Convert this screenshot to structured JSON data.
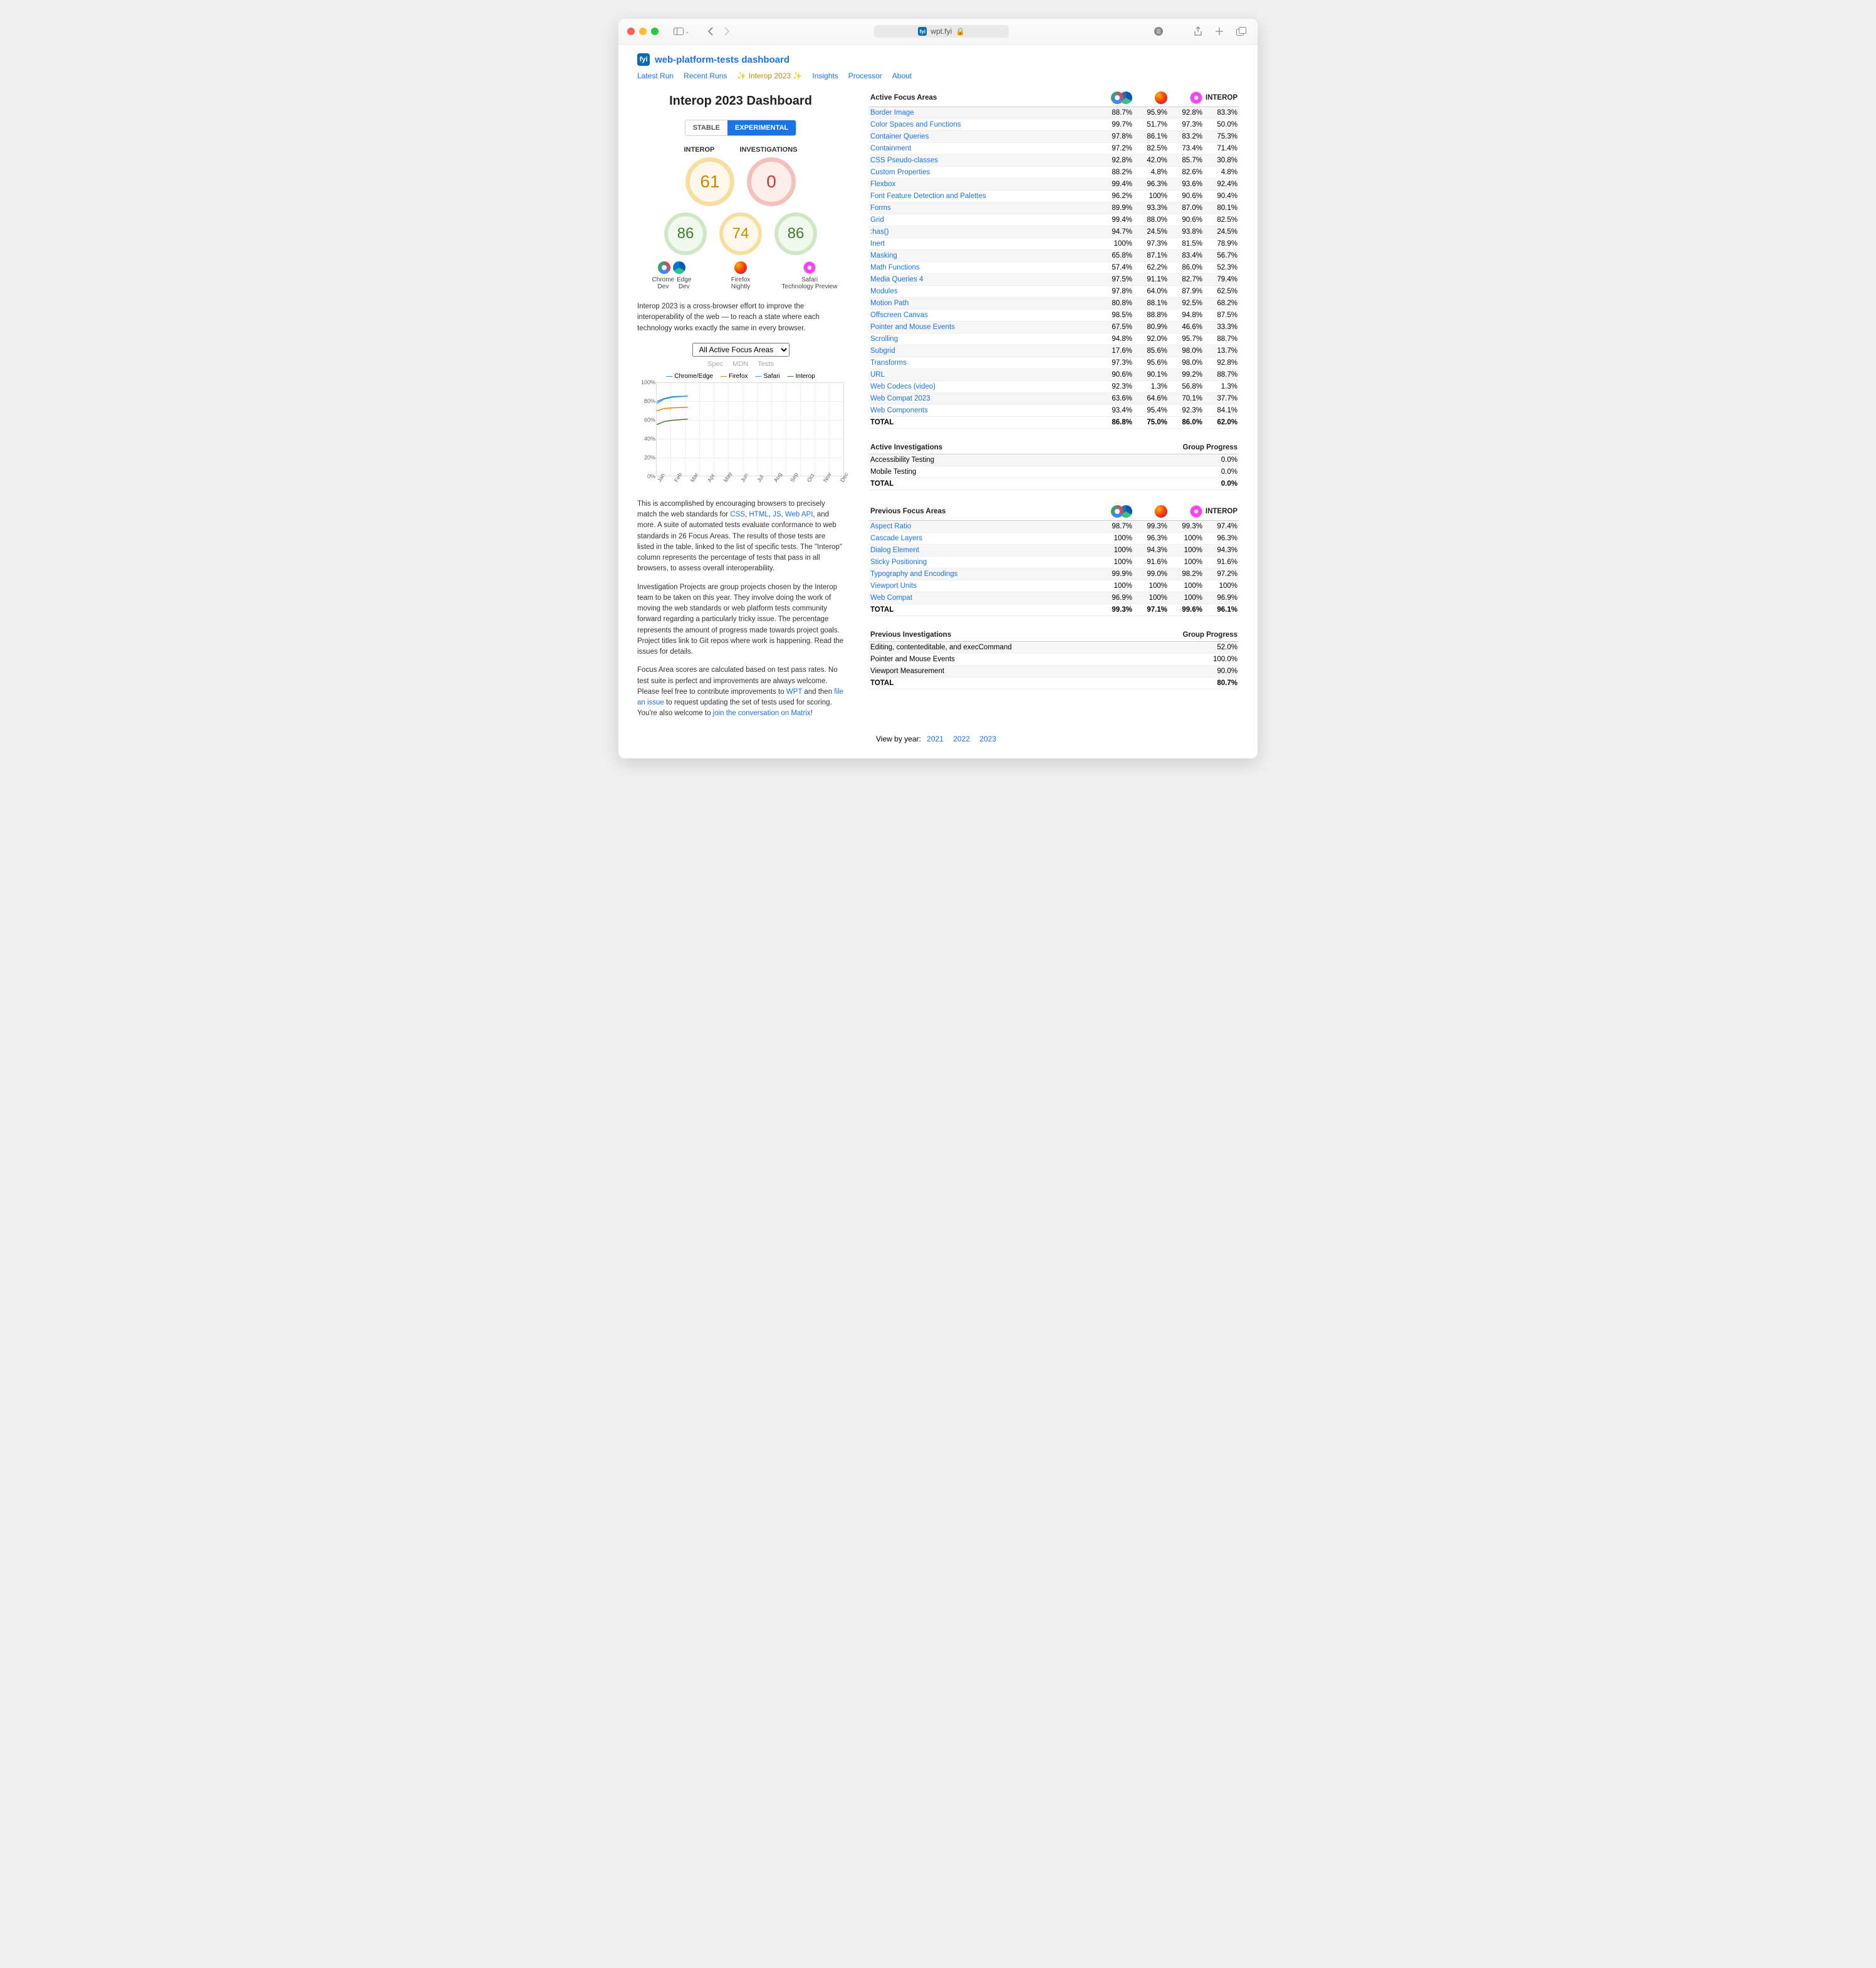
{
  "window": {
    "url": "wpt.fyi"
  },
  "site": {
    "title": "web-platform-tests dashboard",
    "nav": [
      "Latest Run",
      "Recent Runs",
      "✨ Interop 2023 ✨",
      "Insights",
      "Processor",
      "About"
    ]
  },
  "page": {
    "title": "Interop 2023 Dashboard",
    "toggle": {
      "left": "STABLE",
      "right": "EXPERIMENTAL"
    },
    "ring_labels": {
      "interop": "INTEROP",
      "invest": "INVESTIGATIONS"
    },
    "rings": {
      "interop": "61",
      "invest": "0",
      "chrome_edge": "86",
      "firefox": "74",
      "safari": "86"
    },
    "browsers": {
      "col1": "Chrome\nDev",
      "col1b": "Edge\nDev",
      "col2": "Firefox\nNightly",
      "col3": "Safari\nTechnology Preview"
    },
    "intro": "Interop 2023 is a cross-browser effort to improve the interoperability of the web — to reach a state where each technology works exactly the same in every browser.",
    "select": "All Active Focus Areas",
    "sublinks": [
      "Spec",
      "MDN",
      "Tests"
    ],
    "legend": [
      "Chrome/Edge",
      "Firefox",
      "Safari",
      "Interop"
    ],
    "chart": {
      "y": [
        "100%",
        "80%",
        "60%",
        "40%",
        "20%",
        "0%"
      ],
      "x": [
        "Jan",
        "Feb",
        "Mar",
        "Apr",
        "May",
        "Jun",
        "Jul",
        "Aug",
        "Sep",
        "Oct",
        "Nov",
        "Dec"
      ]
    },
    "p2a": "This is accomplished by encouraging browsers to precisely match the web standards for ",
    "p2_links": [
      "CSS",
      "HTML",
      "JS",
      "Web API"
    ],
    "p2b": ", and more. A suite of automated tests evaluate conformance to web standards in 26 Focus Areas. The results of those tests are listed in the table, linked to the list of specific tests. The \"Interop\" column represents the percentage of tests that pass in all browsers, to assess overall interoperability.",
    "p3": "Investigation Projects are group projects chosen by the Interop team to be taken on this year. They involve doing the work of moving the web standards or web platform tests community forward regarding a particularly tricky issue. The percentage represents the amount of progress made towards project goals. Project titles link to Git repos where work is happening. Read the issues for details.",
    "p4a": "Focus Area scores are calculated based on test pass rates. No test suite is perfect and improvements are always welcome. Please feel free to contribute improvements to ",
    "p4_wpt": "WPT",
    "p4b": " and then ",
    "p4_issue": "file an issue",
    "p4c": " to request updating the set of tests used for scoring. You're also welcome to ",
    "p4_matrix": "join the conversation on Matrix",
    "p4d": "!"
  },
  "tables": {
    "active_header": "Active Focus Areas",
    "interop_header": "INTEROP",
    "active_rows": [
      {
        "name": "Border Image",
        "v": [
          "88.7%",
          "95.9%",
          "92.8%",
          "83.3%"
        ]
      },
      {
        "name": "Color Spaces and Functions",
        "v": [
          "99.7%",
          "51.7%",
          "97.3%",
          "50.0%"
        ]
      },
      {
        "name": "Container Queries",
        "v": [
          "97.8%",
          "86.1%",
          "83.2%",
          "75.3%"
        ]
      },
      {
        "name": "Containment",
        "v": [
          "97.2%",
          "82.5%",
          "73.4%",
          "71.4%"
        ]
      },
      {
        "name": "CSS Pseudo-classes",
        "v": [
          "92.8%",
          "42.0%",
          "85.7%",
          "30.8%"
        ]
      },
      {
        "name": "Custom Properties",
        "v": [
          "88.2%",
          "4.8%",
          "82.6%",
          "4.8%"
        ]
      },
      {
        "name": "Flexbox",
        "v": [
          "99.4%",
          "96.3%",
          "93.6%",
          "92.4%"
        ]
      },
      {
        "name": "Font Feature Detection and Palettes",
        "v": [
          "96.2%",
          "100%",
          "90.6%",
          "90.4%"
        ]
      },
      {
        "name": "Forms",
        "v": [
          "89.9%",
          "93.3%",
          "87.0%",
          "80.1%"
        ]
      },
      {
        "name": "Grid",
        "v": [
          "99.4%",
          "88.0%",
          "90.6%",
          "82.5%"
        ]
      },
      {
        "name": ":has()",
        "v": [
          "94.7%",
          "24.5%",
          "93.8%",
          "24.5%"
        ]
      },
      {
        "name": "Inert",
        "v": [
          "100%",
          "97.3%",
          "81.5%",
          "78.9%"
        ]
      },
      {
        "name": "Masking",
        "v": [
          "65.8%",
          "87.1%",
          "83.4%",
          "56.7%"
        ]
      },
      {
        "name": "Math Functions",
        "v": [
          "57.4%",
          "62.2%",
          "86.0%",
          "52.3%"
        ]
      },
      {
        "name": "Media Queries 4",
        "v": [
          "97.5%",
          "91.1%",
          "82.7%",
          "79.4%"
        ]
      },
      {
        "name": "Modules",
        "v": [
          "97.8%",
          "64.0%",
          "87.9%",
          "62.5%"
        ]
      },
      {
        "name": "Motion Path",
        "v": [
          "80.8%",
          "88.1%",
          "92.5%",
          "68.2%"
        ]
      },
      {
        "name": "Offscreen Canvas",
        "v": [
          "98.5%",
          "88.8%",
          "94.8%",
          "87.5%"
        ]
      },
      {
        "name": "Pointer and Mouse Events",
        "v": [
          "67.5%",
          "80.9%",
          "46.6%",
          "33.3%"
        ]
      },
      {
        "name": "Scrolling",
        "v": [
          "94.8%",
          "92.0%",
          "95.7%",
          "88.7%"
        ]
      },
      {
        "name": "Subgrid",
        "v": [
          "17.6%",
          "85.6%",
          "98.0%",
          "13.7%"
        ]
      },
      {
        "name": "Transforms",
        "v": [
          "97.3%",
          "95.6%",
          "98.0%",
          "92.8%"
        ]
      },
      {
        "name": "URL",
        "v": [
          "90.6%",
          "90.1%",
          "99.2%",
          "88.7%"
        ]
      },
      {
        "name": "Web Codecs (video)",
        "v": [
          "92.3%",
          "1.3%",
          "56.8%",
          "1.3%"
        ]
      },
      {
        "name": "Web Compat 2023",
        "v": [
          "63.6%",
          "64.6%",
          "70.1%",
          "37.7%"
        ]
      },
      {
        "name": "Web Components",
        "v": [
          "93.4%",
          "95.4%",
          "92.3%",
          "84.1%"
        ]
      }
    ],
    "active_total": {
      "name": "TOTAL",
      "v": [
        "86.8%",
        "75.0%",
        "86.0%",
        "62.0%"
      ]
    },
    "invest_header": "Active Investigations",
    "invest_col": "Group Progress",
    "invest_rows": [
      {
        "name": "Accessibility Testing",
        "v": "0.0%"
      },
      {
        "name": "Mobile Testing",
        "v": "0.0%"
      }
    ],
    "invest_total": {
      "name": "TOTAL",
      "v": "0.0%"
    },
    "prev_header": "Previous Focus Areas",
    "prev_rows": [
      {
        "name": "Aspect Ratio",
        "v": [
          "98.7%",
          "99.3%",
          "99.3%",
          "97.4%"
        ]
      },
      {
        "name": "Cascade Layers",
        "v": [
          "100%",
          "96.3%",
          "100%",
          "96.3%"
        ]
      },
      {
        "name": "Dialog Element",
        "v": [
          "100%",
          "94.3%",
          "100%",
          "94.3%"
        ]
      },
      {
        "name": "Sticky Positioning",
        "v": [
          "100%",
          "91.6%",
          "100%",
          "91.6%"
        ]
      },
      {
        "name": "Typography and Encodings",
        "v": [
          "99.9%",
          "99.0%",
          "98.2%",
          "97.2%"
        ]
      },
      {
        "name": "Viewport Units",
        "v": [
          "100%",
          "100%",
          "100%",
          "100%"
        ]
      },
      {
        "name": "Web Compat",
        "v": [
          "96.9%",
          "100%",
          "100%",
          "96.9%"
        ]
      }
    ],
    "prev_total": {
      "name": "TOTAL",
      "v": [
        "99.3%",
        "97.1%",
        "99.6%",
        "96.1%"
      ]
    },
    "pinv_header": "Previous Investigations",
    "pinv_col": "Group Progress",
    "pinv_rows": [
      {
        "name": "Editing, contenteditable, and execCommand",
        "v": "52.0%"
      },
      {
        "name": "Pointer and Mouse Events",
        "v": "100.0%"
      },
      {
        "name": "Viewport Measurement",
        "v": "90.0%"
      }
    ],
    "pinv_total": {
      "name": "TOTAL",
      "v": "80.7%"
    }
  },
  "footer": {
    "label": "View by year:",
    "years": [
      "2021",
      "2022",
      "2023"
    ]
  },
  "chart_data": {
    "type": "line",
    "title": "All Active Focus Areas",
    "xlabel": "",
    "ylabel": "",
    "x": [
      "Jan",
      "Feb",
      "Mar",
      "Apr",
      "May",
      "Jun",
      "Jul",
      "Aug",
      "Sep",
      "Oct",
      "Nov",
      "Dec"
    ],
    "ylim": [
      0,
      100
    ],
    "series": [
      {
        "name": "Chrome/Edge",
        "values": [
          80,
          85,
          86,
          null,
          null,
          null,
          null,
          null,
          null,
          null,
          null,
          null
        ]
      },
      {
        "name": "Firefox",
        "values": [
          70,
          73,
          74,
          null,
          null,
          null,
          null,
          null,
          null,
          null,
          null,
          null
        ]
      },
      {
        "name": "Safari",
        "values": [
          78,
          84,
          86,
          null,
          null,
          null,
          null,
          null,
          null,
          null,
          null,
          null
        ]
      },
      {
        "name": "Interop",
        "values": [
          55,
          60,
          61,
          null,
          null,
          null,
          null,
          null,
          null,
          null,
          null,
          null
        ]
      }
    ]
  }
}
